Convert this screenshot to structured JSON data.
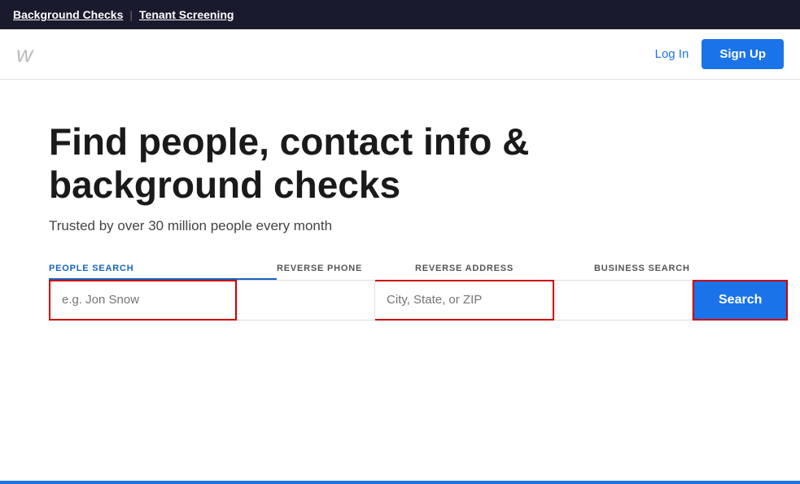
{
  "topbar": {
    "link1": "Background Checks",
    "divider": "|",
    "link2": "Tenant Screening"
  },
  "header": {
    "logo": "w",
    "login_label": "Log In",
    "signup_label": "Sign Up"
  },
  "hero": {
    "title": "Find people, contact info & background checks",
    "subtitle": "Trusted by over 30 million people every month"
  },
  "search": {
    "tabs": [
      {
        "id": "people",
        "label": "PEOPLE SEARCH",
        "active": true
      },
      {
        "id": "phone",
        "label": "REVERSE PHONE",
        "active": false
      },
      {
        "id": "address",
        "label": "REVERSE ADDRESS",
        "active": false
      },
      {
        "id": "business",
        "label": "BUSINESS SEARCH",
        "active": false
      }
    ],
    "name_placeholder": "e.g. Jon Snow",
    "name_value": "",
    "phone_placeholder": "",
    "location_placeholder": "City, State, or ZIP",
    "location_value": "",
    "business_placeholder": "",
    "search_button_label": "Search"
  }
}
